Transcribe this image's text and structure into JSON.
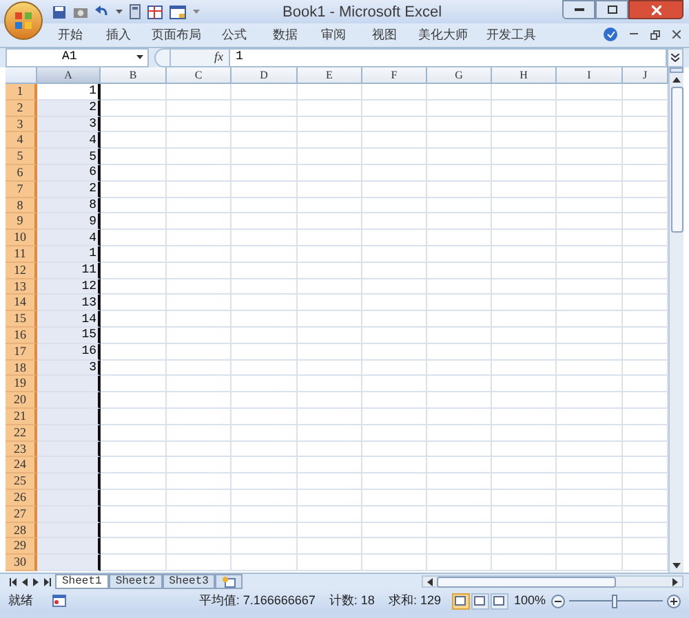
{
  "window": {
    "title": "Book1 - Microsoft Excel"
  },
  "ribbon_tabs": [
    {
      "label": "开始",
      "selected": false
    },
    {
      "label": "插入",
      "selected": false
    },
    {
      "label": "页面布局",
      "selected": false
    },
    {
      "label": "公式",
      "selected": false
    },
    {
      "label": "数据",
      "selected": false
    },
    {
      "label": "审阅",
      "selected": false
    },
    {
      "label": "视图",
      "selected": false
    },
    {
      "label": "美化大师",
      "selected": false
    },
    {
      "label": "开发工具",
      "selected": false
    }
  ],
  "formula_bar": {
    "name_box": "A1",
    "fx": "fx",
    "value": "1"
  },
  "columns": [
    {
      "label": "A",
      "selected": true
    },
    {
      "label": "B",
      "selected": false
    },
    {
      "label": "C",
      "selected": false
    },
    {
      "label": "D",
      "selected": false
    },
    {
      "label": "E",
      "selected": false
    },
    {
      "label": "F",
      "selected": false
    },
    {
      "label": "G",
      "selected": false
    },
    {
      "label": "H",
      "selected": false
    },
    {
      "label": "I",
      "selected": false
    },
    {
      "label": "J",
      "selected": false
    }
  ],
  "rows": [
    {
      "number": "1",
      "a": "1",
      "selected": true
    },
    {
      "number": "2",
      "a": "2",
      "selected": true
    },
    {
      "number": "3",
      "a": "3",
      "selected": true
    },
    {
      "number": "4",
      "a": "4",
      "selected": true
    },
    {
      "number": "5",
      "a": "5",
      "selected": true
    },
    {
      "number": "6",
      "a": "6",
      "selected": true
    },
    {
      "number": "7",
      "a": "2",
      "selected": true
    },
    {
      "number": "8",
      "a": "8",
      "selected": true
    },
    {
      "number": "9",
      "a": "9",
      "selected": true
    },
    {
      "number": "10",
      "a": "4",
      "selected": true
    },
    {
      "number": "11",
      "a": "1",
      "selected": true
    },
    {
      "number": "12",
      "a": "11",
      "selected": true
    },
    {
      "number": "13",
      "a": "12",
      "selected": true
    },
    {
      "number": "14",
      "a": "13",
      "selected": true
    },
    {
      "number": "15",
      "a": "14",
      "selected": true
    },
    {
      "number": "16",
      "a": "15",
      "selected": true
    },
    {
      "number": "17",
      "a": "16",
      "selected": true
    },
    {
      "number": "18",
      "a": "3",
      "selected": true
    },
    {
      "number": "19",
      "selected": true
    },
    {
      "number": "20",
      "selected": true
    },
    {
      "number": "21",
      "selected": true
    },
    {
      "number": "22",
      "selected": true
    },
    {
      "number": "23",
      "selected": true
    },
    {
      "number": "24",
      "selected": true
    },
    {
      "number": "25",
      "selected": true
    },
    {
      "number": "26",
      "selected": true
    },
    {
      "number": "27",
      "selected": true
    },
    {
      "number": "28",
      "selected": true
    },
    {
      "number": "29",
      "selected": true
    },
    {
      "number": "30",
      "selected": true
    }
  ],
  "sheet_tabs": [
    {
      "label": "Sheet1",
      "selected": true
    },
    {
      "label": "Sheet2",
      "selected": false
    },
    {
      "label": "Sheet3",
      "selected": false
    }
  ],
  "status_bar": {
    "mode": "就绪",
    "average": "平均值: 7.166666667",
    "count": "计数: 18",
    "sum": "求和: 129",
    "zoom": "100%",
    "zoom_slider": {
      "level": 0.48
    },
    "views": [
      {
        "selected": true
      },
      {
        "selected": false
      },
      {
        "selected": false
      }
    ]
  }
}
